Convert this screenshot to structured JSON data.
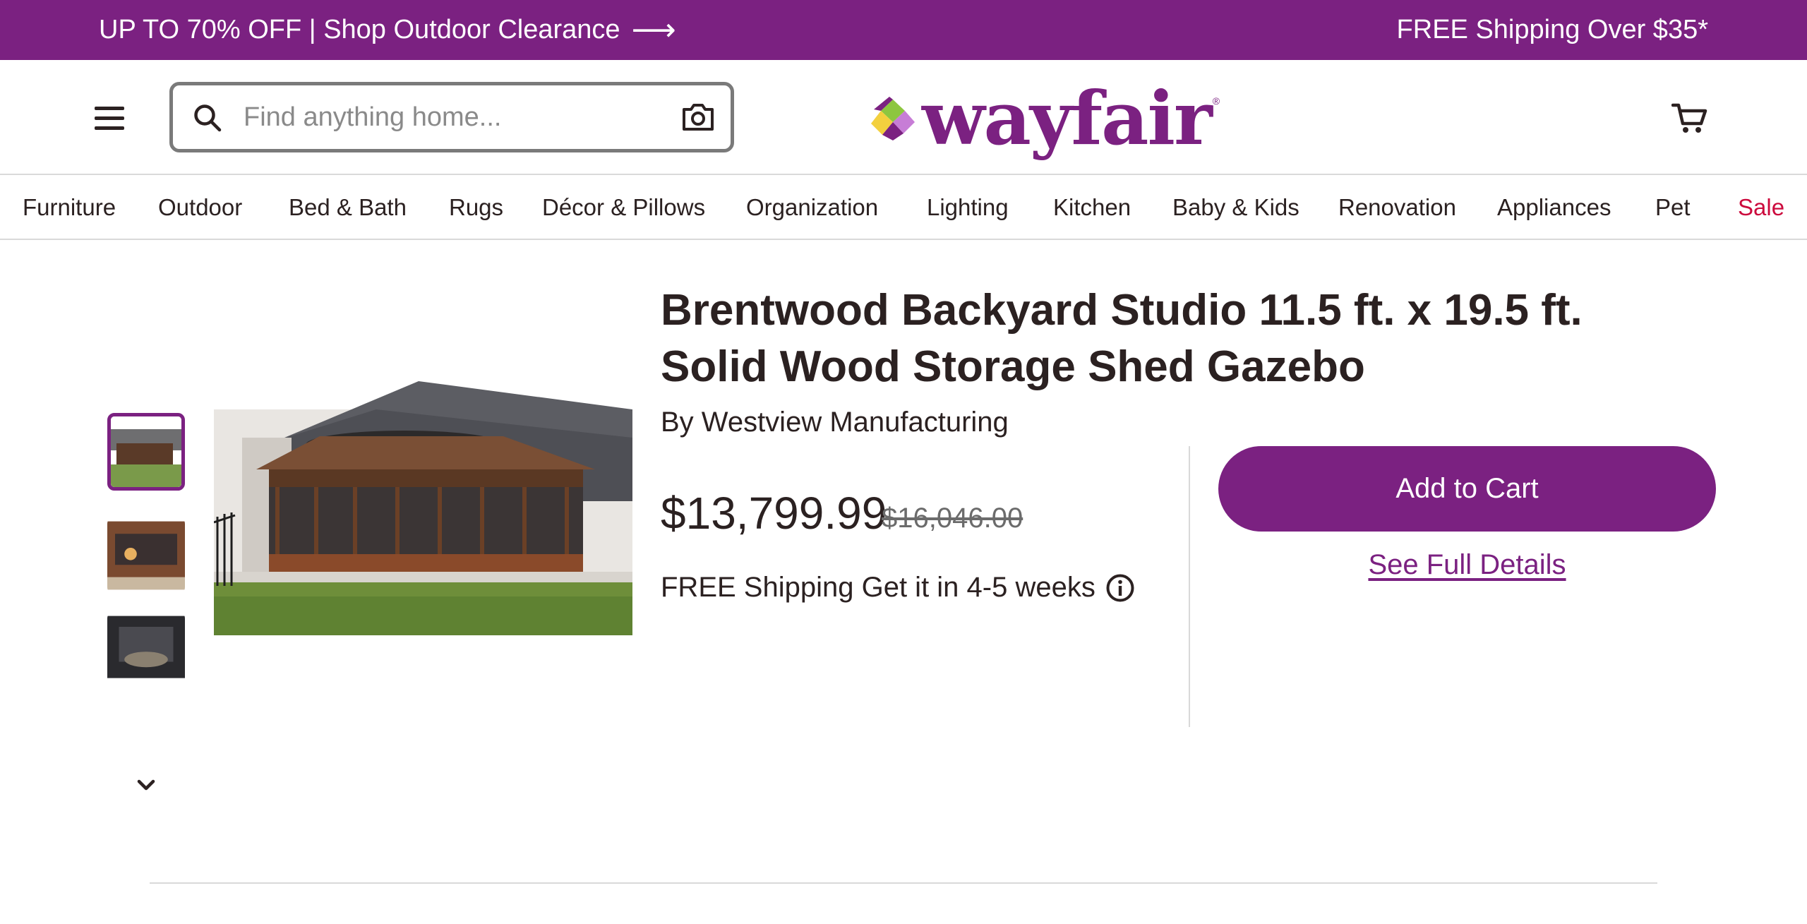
{
  "promo": {
    "left_text": "UP TO 70% OFF | Shop Outdoor Clearance",
    "left_arrow": "⟶",
    "right_text": "FREE Shipping Over $35*"
  },
  "header": {
    "search_placeholder": "Find anything home...",
    "logo_text": "wayfair",
    "logo_mark": "®"
  },
  "categories": [
    "Furniture",
    "Outdoor",
    "Bed & Bath",
    "Rugs",
    "Décor & Pillows",
    "Organization",
    "Lighting",
    "Kitchen",
    "Baby & Kids",
    "Renovation",
    "Appliances",
    "Pet",
    "Sale"
  ],
  "product": {
    "title": "Brentwood Backyard Studio 11.5 ft. x 19.5 ft. Solid Wood Storage Shed Gazebo",
    "brand": "By Westview Manufacturing",
    "price": "$13,799.99",
    "original_price": "$16,046.00",
    "shipping": "FREE Shipping Get it in 4-5 weeks",
    "add_to_cart": "Add to Cart",
    "see_details": "See Full Details"
  },
  "icons": {
    "menu": "hamburger-icon",
    "search": "search-icon",
    "camera": "camera-icon",
    "cart": "cart-icon",
    "info": "info-icon",
    "thumb_scroll": "chevron-down-icon"
  },
  "colors": {
    "brand_purple": "#7b2181",
    "sale_red": "#cc0a3d",
    "text": "#2b2121"
  }
}
